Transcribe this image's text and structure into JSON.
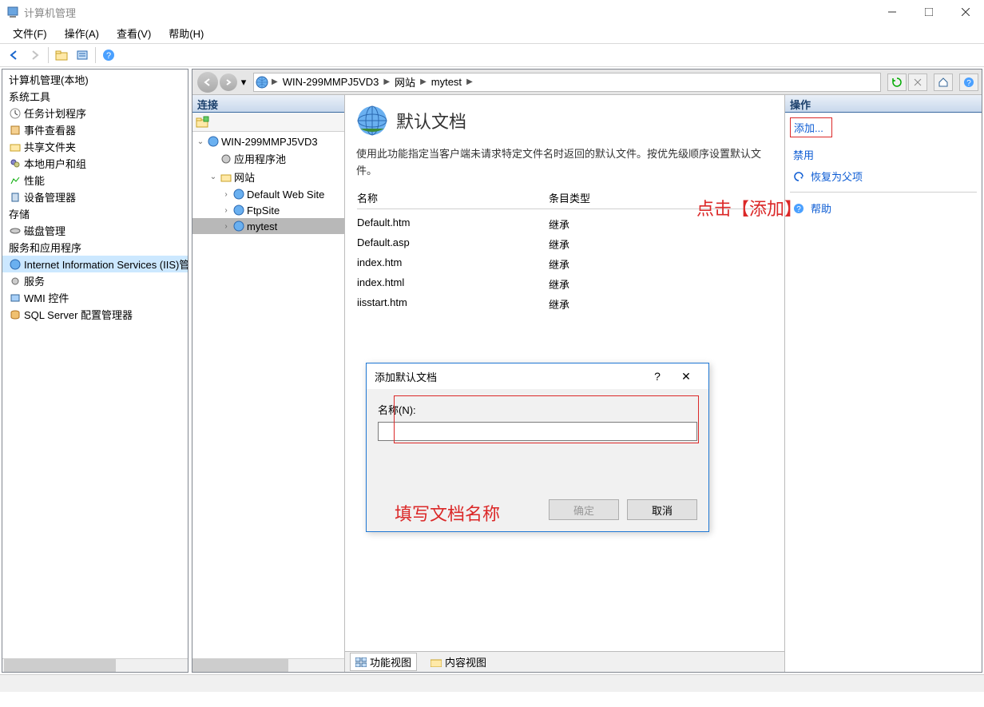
{
  "window": {
    "title": "计算机管理"
  },
  "menu": {
    "file": "文件(F)",
    "action": "操作(A)",
    "view": "查看(V)",
    "help": "帮助(H)"
  },
  "left_tree": {
    "root": "计算机管理(本地)",
    "nodes": [
      "系统工具",
      "任务计划程序",
      "事件查看器",
      "共享文件夹",
      "本地用户和组",
      "性能",
      "设备管理器",
      "存储",
      "磁盘管理",
      "服务和应用程序",
      "Internet Information Services (IIS)管理器",
      "服务",
      "WMI 控件",
      "SQL Server 配置管理器"
    ]
  },
  "breadcrumb": {
    "server": "WIN-299MMPJ5VD3",
    "sites": "网站",
    "site": "mytest"
  },
  "connections": {
    "title": "连接",
    "server": "WIN-299MMPJ5VD3",
    "app_pools": "应用程序池",
    "sites": "网站",
    "site_list": [
      "Default Web Site",
      "FtpSite",
      "mytest"
    ]
  },
  "content": {
    "title": "默认文档",
    "description": "使用此功能指定当客户端未请求特定文件名时返回的默认文件。按优先级顺序设置默认文件。",
    "col_name": "名称",
    "col_type": "条目类型",
    "rows": [
      {
        "name": "Default.htm",
        "type": "继承"
      },
      {
        "name": "Default.asp",
        "type": "继承"
      },
      {
        "name": "index.htm",
        "type": "继承"
      },
      {
        "name": "index.html",
        "type": "继承"
      },
      {
        "name": "iisstart.htm",
        "type": "继承"
      }
    ],
    "tab_feature": "功能视图",
    "tab_content": "内容视图"
  },
  "actions": {
    "title": "操作",
    "add": "添加...",
    "disable": "禁用",
    "revert": "恢复为父项",
    "help": "帮助"
  },
  "dialog": {
    "title": "添加默认文档",
    "label": "名称(N):",
    "value": "",
    "ok": "确定",
    "cancel": "取消"
  },
  "annotations": {
    "click_add": "点击【添加】",
    "fill_name": "填写文档名称"
  }
}
